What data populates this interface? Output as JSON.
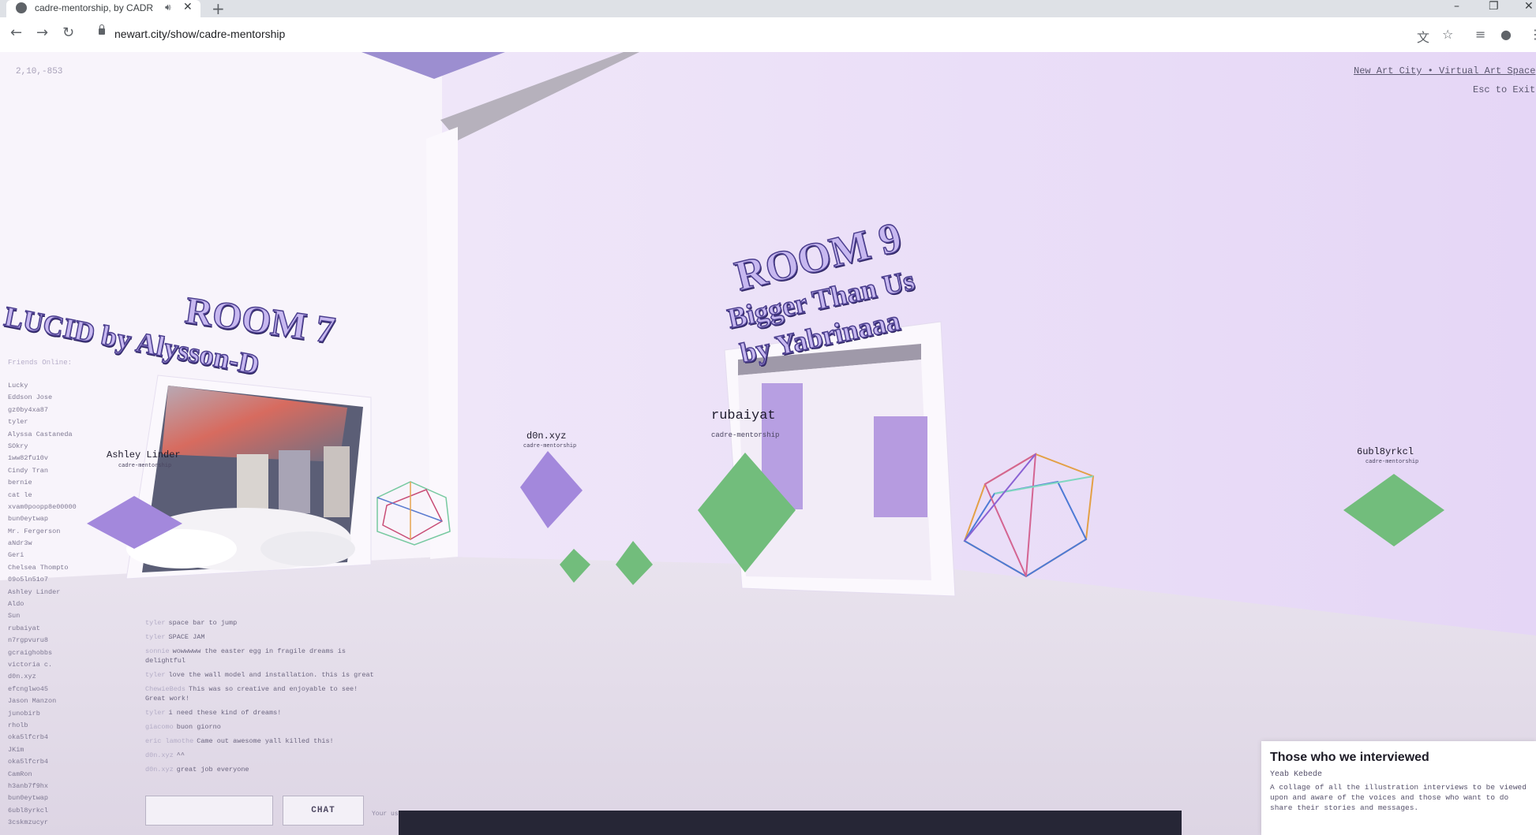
{
  "browser": {
    "tab_title": "cadre-mentorship, by CADRE",
    "url": "newart.city/show/cadre-mentorship"
  },
  "hud": {
    "coordinates": "2,10,-853",
    "site_link": "New Art City • Virtual Art Space",
    "exit_hint": "Esc to Exit"
  },
  "rooms": [
    {
      "room": "ROOM 7",
      "title": "LUCID by Alysson-D"
    },
    {
      "room": "ROOM 9",
      "title": "Bigger Than Us",
      "byline": "by Yabrinaaa"
    }
  ],
  "avatars": [
    {
      "name": "Ashley Linder",
      "sub": "cadre-mentorship"
    },
    {
      "name": "d0n.xyz",
      "sub": "cadre-mentorship"
    },
    {
      "name": "rubaiyat",
      "sub": "cadre-mentorship"
    },
    {
      "name": "6ubl8yrkcl",
      "sub": "cadre-mentorship"
    }
  ],
  "friends": {
    "heading": "Friends Online:",
    "names": [
      "Lucky",
      "Eddson Jose",
      "gz0by4xa87",
      "tyler",
      "Alyssa Castaneda",
      "SOkry",
      "1ww82fu10v",
      "Cindy Tran",
      "bernie",
      "cat le",
      "xvam0poopp8e00000",
      "bun0eytwap",
      "Mr. Fergerson",
      "aNdr3w",
      "Geri",
      "Chelsea Thompto",
      "09o5ln51o7",
      "Ashley Linder",
      "Aldo",
      "Sun",
      "rubaiyat",
      "n7rgpvuru8",
      "gcraighobbs",
      "victoria c.",
      "d0n.xyz",
      "efcnglwo45",
      "Jason Manzon",
      "junobirb",
      "rholb",
      "oka5lfcrb4",
      "JKim",
      "oka5lfcrb4",
      "CamRon",
      "h3anb7f9hx",
      "bun0eytwap",
      "6ubl8yrkcl",
      "3cskmzucyr"
    ]
  },
  "chat": {
    "messages": [
      {
        "who": "tyler",
        "text": "space bar to jump"
      },
      {
        "who": "tyler",
        "text": "SPACE JAM"
      },
      {
        "who": "sonnie",
        "text": "wowwwww the easter egg in fragile dreams is delightful"
      },
      {
        "who": "tyler",
        "text": "love the wall model and installation. this is great"
      },
      {
        "who": "ChewieBeds",
        "text": "This was so creative and enjoyable to see! Great work!"
      },
      {
        "who": "tyler",
        "text": "i need these kind of dreams!"
      },
      {
        "who": "giacomo",
        "text": "buon giorno"
      },
      {
        "who": "eric lamothe",
        "text": "Came out awesome yall killed this!"
      },
      {
        "who": "d0n.xyz",
        "text": "^^"
      },
      {
        "who": "d0n.xyz",
        "text": "great job everyone"
      }
    ],
    "input_placeholder": "",
    "button_label": "CHAT",
    "hint": "Your us"
  },
  "info_panel": {
    "title": "Those who we interviewed",
    "author": "Yeab Kebede",
    "description": "A collage of all the illustration interviews to be viewed upon and aware of the voices and those who want to do share their stories and messages."
  },
  "colors": {
    "wall": "#eee4f8",
    "floor": "#ddd5e4",
    "purple_avatar": "#a388dc",
    "green_avatar": "#72bd7c",
    "bottom_bar": "#262636"
  }
}
